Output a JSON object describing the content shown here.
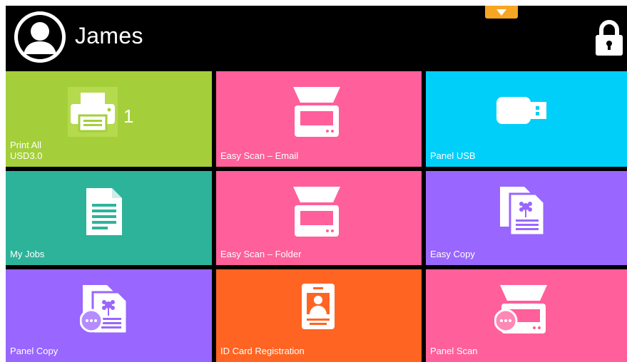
{
  "header": {
    "user_name": "James",
    "avatar_icon": "user-avatar-icon",
    "pull_tab_icon": "chevron-down-icon",
    "lock_icon": "lock-icon"
  },
  "tiles": [
    {
      "id": "print-all",
      "label_line1": "Print All",
      "label_line2": "USD3.0",
      "count": "1",
      "color": "#a4cf3a",
      "icon": "printer-icon"
    },
    {
      "id": "easy-scan-email",
      "label": "Easy Scan – Email",
      "color": "#ff5f9a",
      "icon": "scanner-icon"
    },
    {
      "id": "panel-usb",
      "label": "Panel USB",
      "color": "#00cffa",
      "icon": "usb-drive-icon"
    },
    {
      "id": "my-jobs",
      "label": "My Jobs",
      "color": "#2db39a",
      "icon": "document-icon"
    },
    {
      "id": "easy-scan-folder",
      "label": "Easy Scan – Folder",
      "color": "#ff5f9a",
      "icon": "scanner-icon"
    },
    {
      "id": "easy-copy",
      "label": "Easy Copy",
      "color": "#9966ff",
      "icon": "copy-documents-icon"
    },
    {
      "id": "panel-copy",
      "label": "Panel Copy",
      "color": "#9966ff",
      "icon": "copy-documents-more-icon"
    },
    {
      "id": "id-card-registration",
      "label": "ID Card Registration",
      "color": "#ff6422",
      "icon": "id-card-icon"
    },
    {
      "id": "panel-scan",
      "label": "Panel Scan",
      "color": "#ff5f9a",
      "icon": "scanner-more-icon"
    }
  ]
}
